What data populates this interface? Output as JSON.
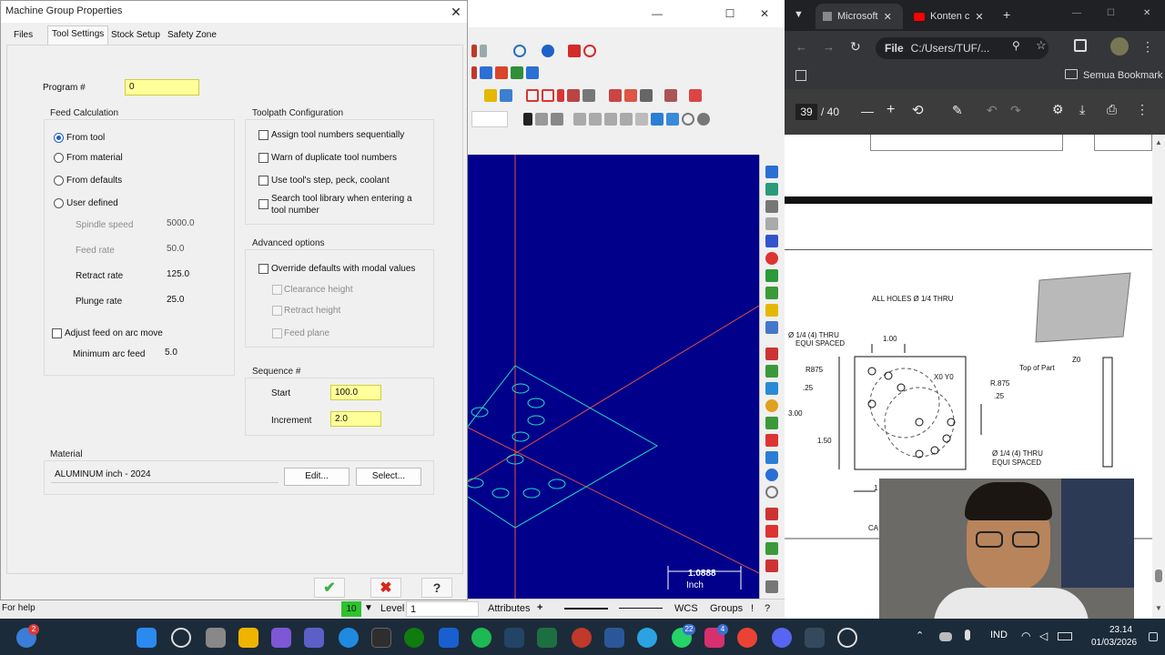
{
  "dialog": {
    "title": "Machine Group Properties",
    "close_label": "✕",
    "tabs": [
      "Files",
      "Tool Settings",
      "Stock Setup",
      "Safety Zone"
    ],
    "program_label": "Program #",
    "program_value": "0",
    "feed_calc": {
      "title": "Feed Calculation",
      "options": [
        "From tool",
        "From material",
        "From defaults",
        "User defined"
      ],
      "spindle_label": "Spindle speed",
      "spindle_value": "5000.0",
      "feed_label": "Feed rate",
      "feed_value": "50.0",
      "retract_label": "Retract rate",
      "retract_value": "125.0",
      "plunge_label": "Plunge rate",
      "plunge_value": "25.0",
      "adjust_label": "Adjust feed on arc move",
      "minarc_label": "Minimum arc feed",
      "minarc_value": "5.0"
    },
    "toolpath": {
      "title": "Toolpath Configuration",
      "options": [
        "Assign tool numbers sequentially",
        "Warn of duplicate tool numbers",
        "Use tool's step, peck, coolant",
        "Search tool library when entering a",
        "tool number"
      ]
    },
    "advanced": {
      "title": "Advanced options",
      "override_label": "Override defaults with modal values",
      "sub_options": [
        "Clearance height",
        "Retract height",
        "Feed plane"
      ]
    },
    "sequence": {
      "title": "Sequence #",
      "start_label": "Start",
      "start_value": "100.0",
      "increment_label": "Increment",
      "increment_value": "2.0"
    },
    "material": {
      "title": "Material",
      "value": "ALUMINUM inch - 2024",
      "edit_label": "Edit...",
      "select_label": "Select..."
    },
    "footer": {
      "ok": "✔",
      "cancel": "✖",
      "help": "?"
    }
  },
  "cad": {
    "scale_value": "1.0888",
    "scale_unit": "Inch",
    "status": {
      "help": "For help",
      "level_value": "10",
      "level_label": "Level",
      "level_field": "1",
      "attributes": "Attributes",
      "plus": "+",
      "wcs": "WCS",
      "groups": "Groups",
      "bang": "!",
      "q": "?"
    }
  },
  "browser": {
    "tab1": "Microsoft",
    "tab2": "Konten c",
    "url_prefix": "File",
    "url": "C:/Users/TUF/...",
    "bookmarks": "Semua Bookmark",
    "pdf_page": "39",
    "pdf_total": "/ 40",
    "drawing": {
      "all_holes": "ALL HOLES  Ø 1/4 THRU",
      "dia_note_1": "Ø 1/4  (4) THRU",
      "equi_1": "EQUI SPACED",
      "dim_100": "1.00",
      "r875_left": "R875",
      "x0y0": "X0 Y0",
      "r875_right": "R.875",
      "dim_25a": ".25",
      "dim_25b": ".25",
      "dim_300": "3.00",
      "dim_150": "1.50",
      "dia_note_2": "Ø 1/4  (4) THRU",
      "equi_2": "EQUI SPACED",
      "top_of_part": "Top of Part",
      "z0": "Z0",
      "dim_1": "1",
      "ca": "CA"
    }
  },
  "taskbar": {
    "badge_left": "2",
    "badge_whatsapp": "22",
    "badge_insta": "4",
    "lang": "IND",
    "time": "23.14",
    "date": "01/03/2026"
  }
}
